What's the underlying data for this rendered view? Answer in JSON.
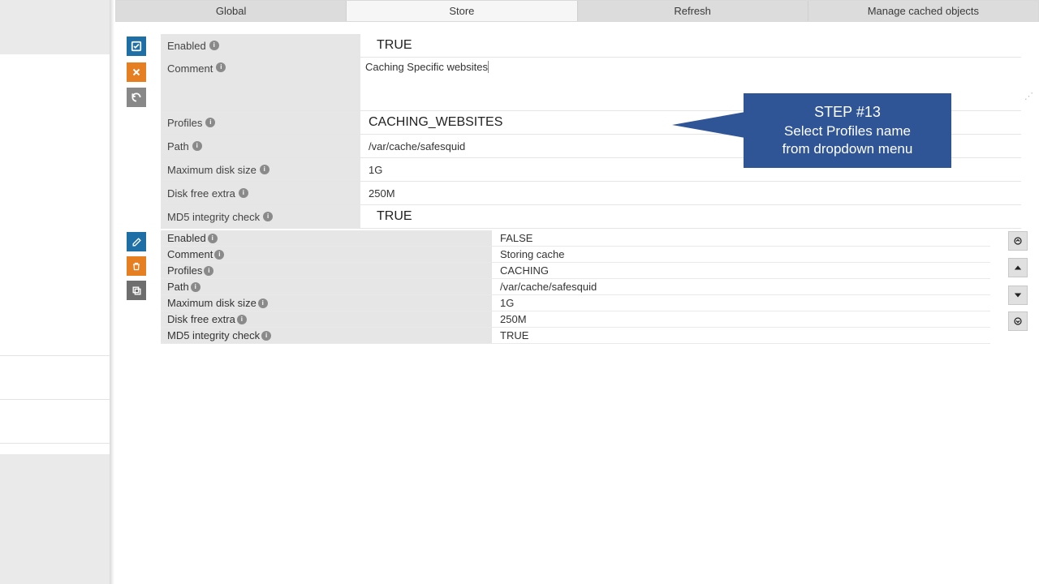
{
  "tabs": {
    "global": "Global",
    "store": "Store",
    "refresh": "Refresh",
    "manage": "Manage cached objects"
  },
  "edit": {
    "labels": {
      "enabled": "Enabled",
      "comment": "Comment",
      "profiles": "Profiles",
      "path": "Path",
      "maxdisk": "Maximum disk size",
      "diskfree": "Disk free extra",
      "md5": "MD5 integrity check"
    },
    "values": {
      "enabled": "TRUE",
      "comment": "Caching Specific websites",
      "profiles": "CACHING_WEBSITES",
      "path": "/var/cache/safesquid",
      "maxdisk": "1G",
      "diskfree": "250M",
      "md5": "TRUE"
    }
  },
  "list": {
    "values": {
      "enabled": "FALSE",
      "comment": "Storing cache",
      "profiles": "CACHING",
      "path": "/var/cache/safesquid",
      "maxdisk": "1G",
      "diskfree": "250M",
      "md5": "TRUE"
    }
  },
  "callout": {
    "title": "STEP #13",
    "line1": "Select Profiles name",
    "line2": "from dropdown menu"
  }
}
